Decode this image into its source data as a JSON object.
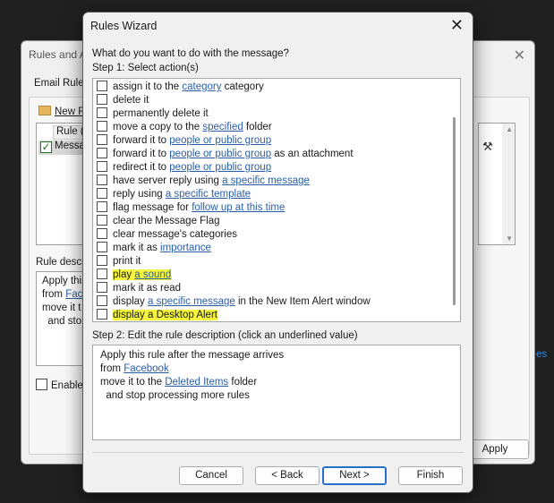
{
  "background_dialog": {
    "title": "Rules and A",
    "close_icon": "close-icon",
    "tab_label": "Email Rules",
    "new_rule": "New R",
    "list_header": "Rule (a",
    "list_row": "Messa",
    "desc_label": "Rule descr",
    "desc_lines": [
      "Apply this",
      "from ",
      "move it t",
      "  and sto"
    ],
    "desc_link": "Fac",
    "enable_label": "Enable",
    "right_link": "es",
    "apply_label": "Apply"
  },
  "wizard": {
    "title": "Rules Wizard",
    "question": "What do you want to do with the message?",
    "step1_label": "Step 1: Select action(s)",
    "actions": [
      {
        "pre": "assign it to the ",
        "link": "category",
        "post": " category"
      },
      {
        "pre": "delete it",
        "link": "",
        "post": ""
      },
      {
        "pre": "permanently delete it",
        "link": "",
        "post": ""
      },
      {
        "pre": "move a copy to the ",
        "link": "specified",
        "post": " folder"
      },
      {
        "pre": "forward it to ",
        "link": "people or public group",
        "post": ""
      },
      {
        "pre": "forward it to ",
        "link": "people or public group",
        "post": " as an attachment"
      },
      {
        "pre": "redirect it to ",
        "link": "people or public group",
        "post": ""
      },
      {
        "pre": "have server reply using ",
        "link": "a specific message",
        "post": ""
      },
      {
        "pre": "reply using ",
        "link": "a specific template",
        "post": ""
      },
      {
        "pre": "flag message for ",
        "link": "follow up at this time",
        "post": ""
      },
      {
        "pre": "clear the Message Flag",
        "link": "",
        "post": ""
      },
      {
        "pre": "clear message's categories",
        "link": "",
        "post": ""
      },
      {
        "pre": "mark it as ",
        "link": "importance",
        "post": ""
      },
      {
        "pre": "print it",
        "link": "",
        "post": ""
      },
      {
        "pre": "play ",
        "link": "a sound",
        "post": ""
      },
      {
        "pre": "mark it as read",
        "link": "",
        "post": ""
      },
      {
        "pre": "display ",
        "link": "a specific message",
        "post": " in the New Item Alert window"
      },
      {
        "pre": "display a Desktop Alert",
        "link": "",
        "post": ""
      }
    ],
    "highlight_color": "#f5f53a",
    "link_color": "#2a5ea8",
    "step2_label": "Step 2: Edit the rule description (click an underlined value)",
    "desc": {
      "line1": "Apply this rule after the message arrives",
      "line2_pre": "from ",
      "line2_link": "Facebook",
      "line3_pre": "move it to the ",
      "line3_link": "Deleted Items",
      "line3_post": " folder",
      "line4": "  and stop processing more rules"
    },
    "buttons": {
      "cancel": "Cancel",
      "back": "< Back",
      "next": "Next >",
      "finish": "Finish"
    }
  }
}
